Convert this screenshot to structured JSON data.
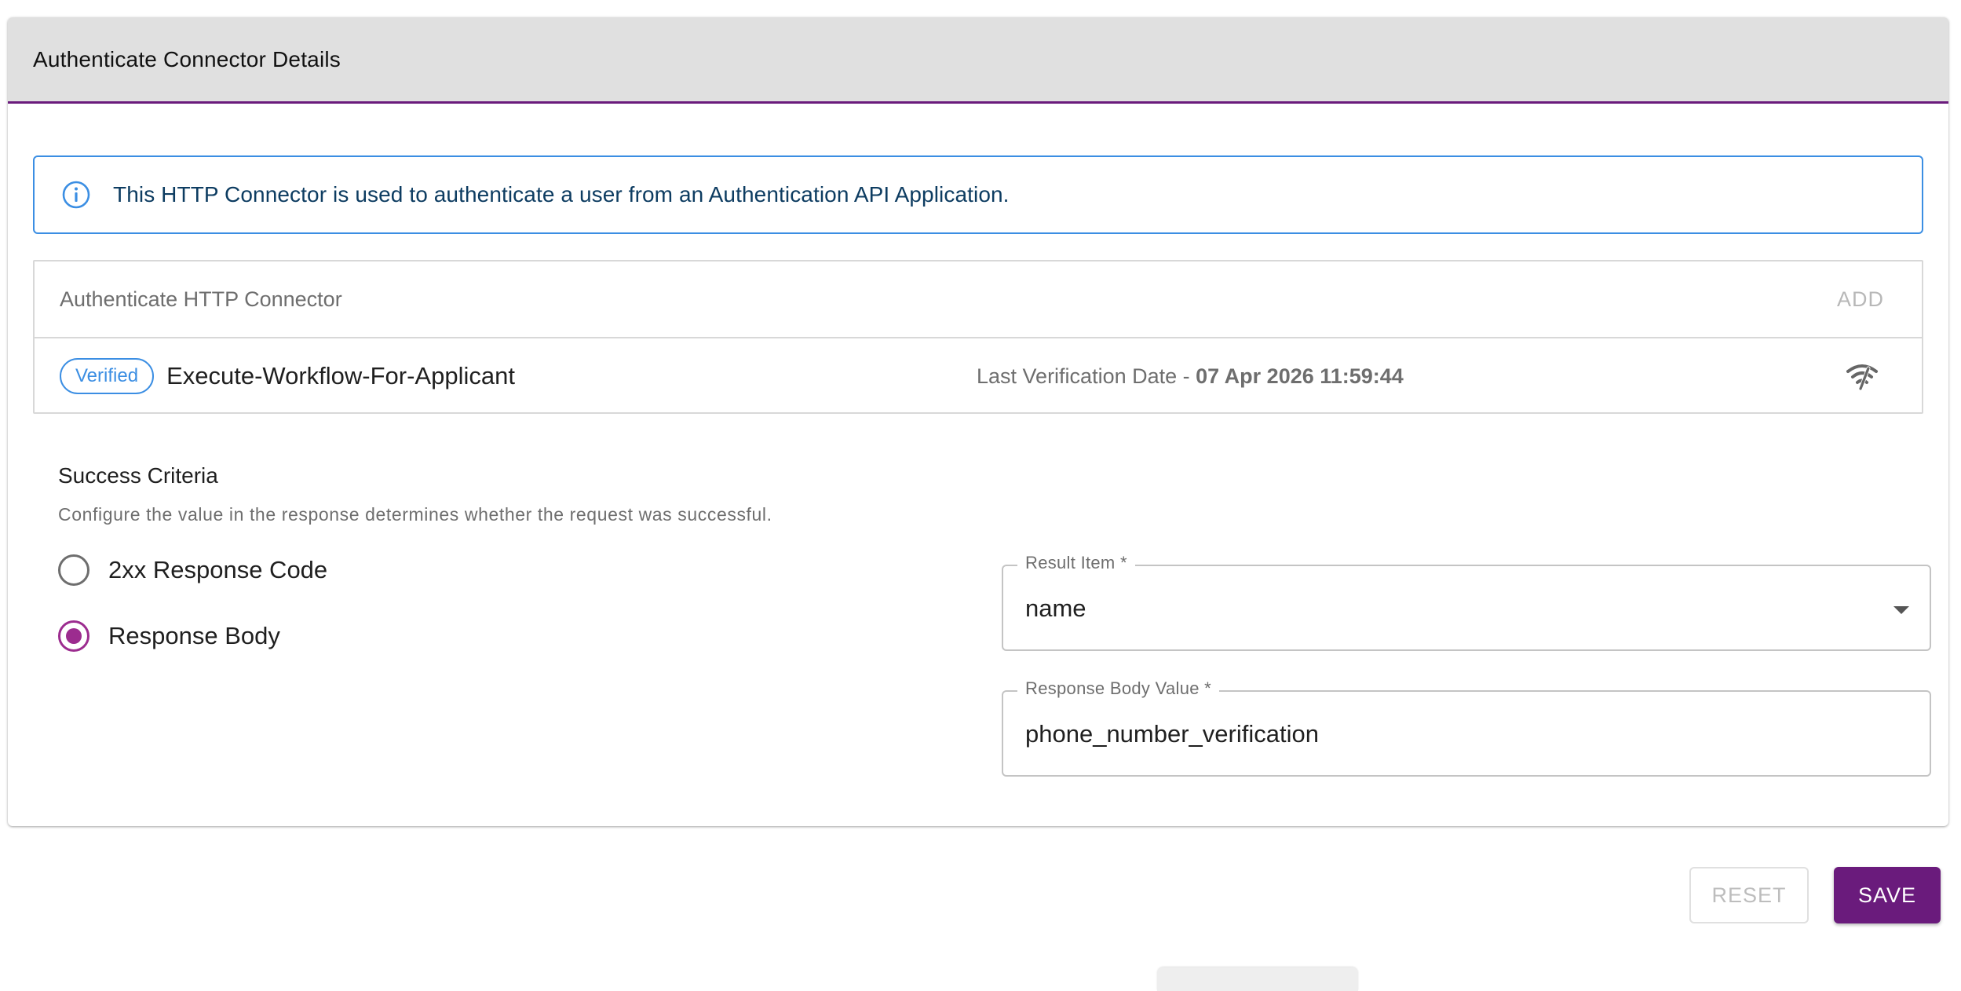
{
  "header": {
    "title": "Authenticate Connector Details"
  },
  "info_alert": {
    "text": "This HTTP Connector is used to authenticate a user from an Authentication API Application.",
    "icon": "info-icon",
    "color": "#3b8ee3"
  },
  "connector_section": {
    "title": "Authenticate HTTP Connector",
    "add_label": "ADD",
    "row": {
      "badge": "Verified",
      "name": "Execute-Workflow-For-Applicant",
      "last_verified_label": "Last Verification Date - ",
      "last_verified_date": "07 Apr 2026 11:59:44",
      "action_icon": "signal-test-icon"
    }
  },
  "success_criteria": {
    "title": "Success Criteria",
    "description": "Configure the value in the response determines whether the request was successful.",
    "options": [
      {
        "label": "2xx Response Code",
        "checked": false
      },
      {
        "label": "Response Body",
        "checked": true
      }
    ],
    "result_item": {
      "label": "Result Item *",
      "value": "name"
    },
    "response_body_value": {
      "label": "Response Body Value *",
      "value": "phone_number_verification"
    }
  },
  "actions": {
    "reset_label": "RESET",
    "save_label": "SAVE"
  },
  "colors": {
    "primary": "#6a1b7c",
    "radio_checked": "#9c2c8f",
    "info_blue": "#3b8ee3",
    "header_bg": "#e0e0e0"
  }
}
